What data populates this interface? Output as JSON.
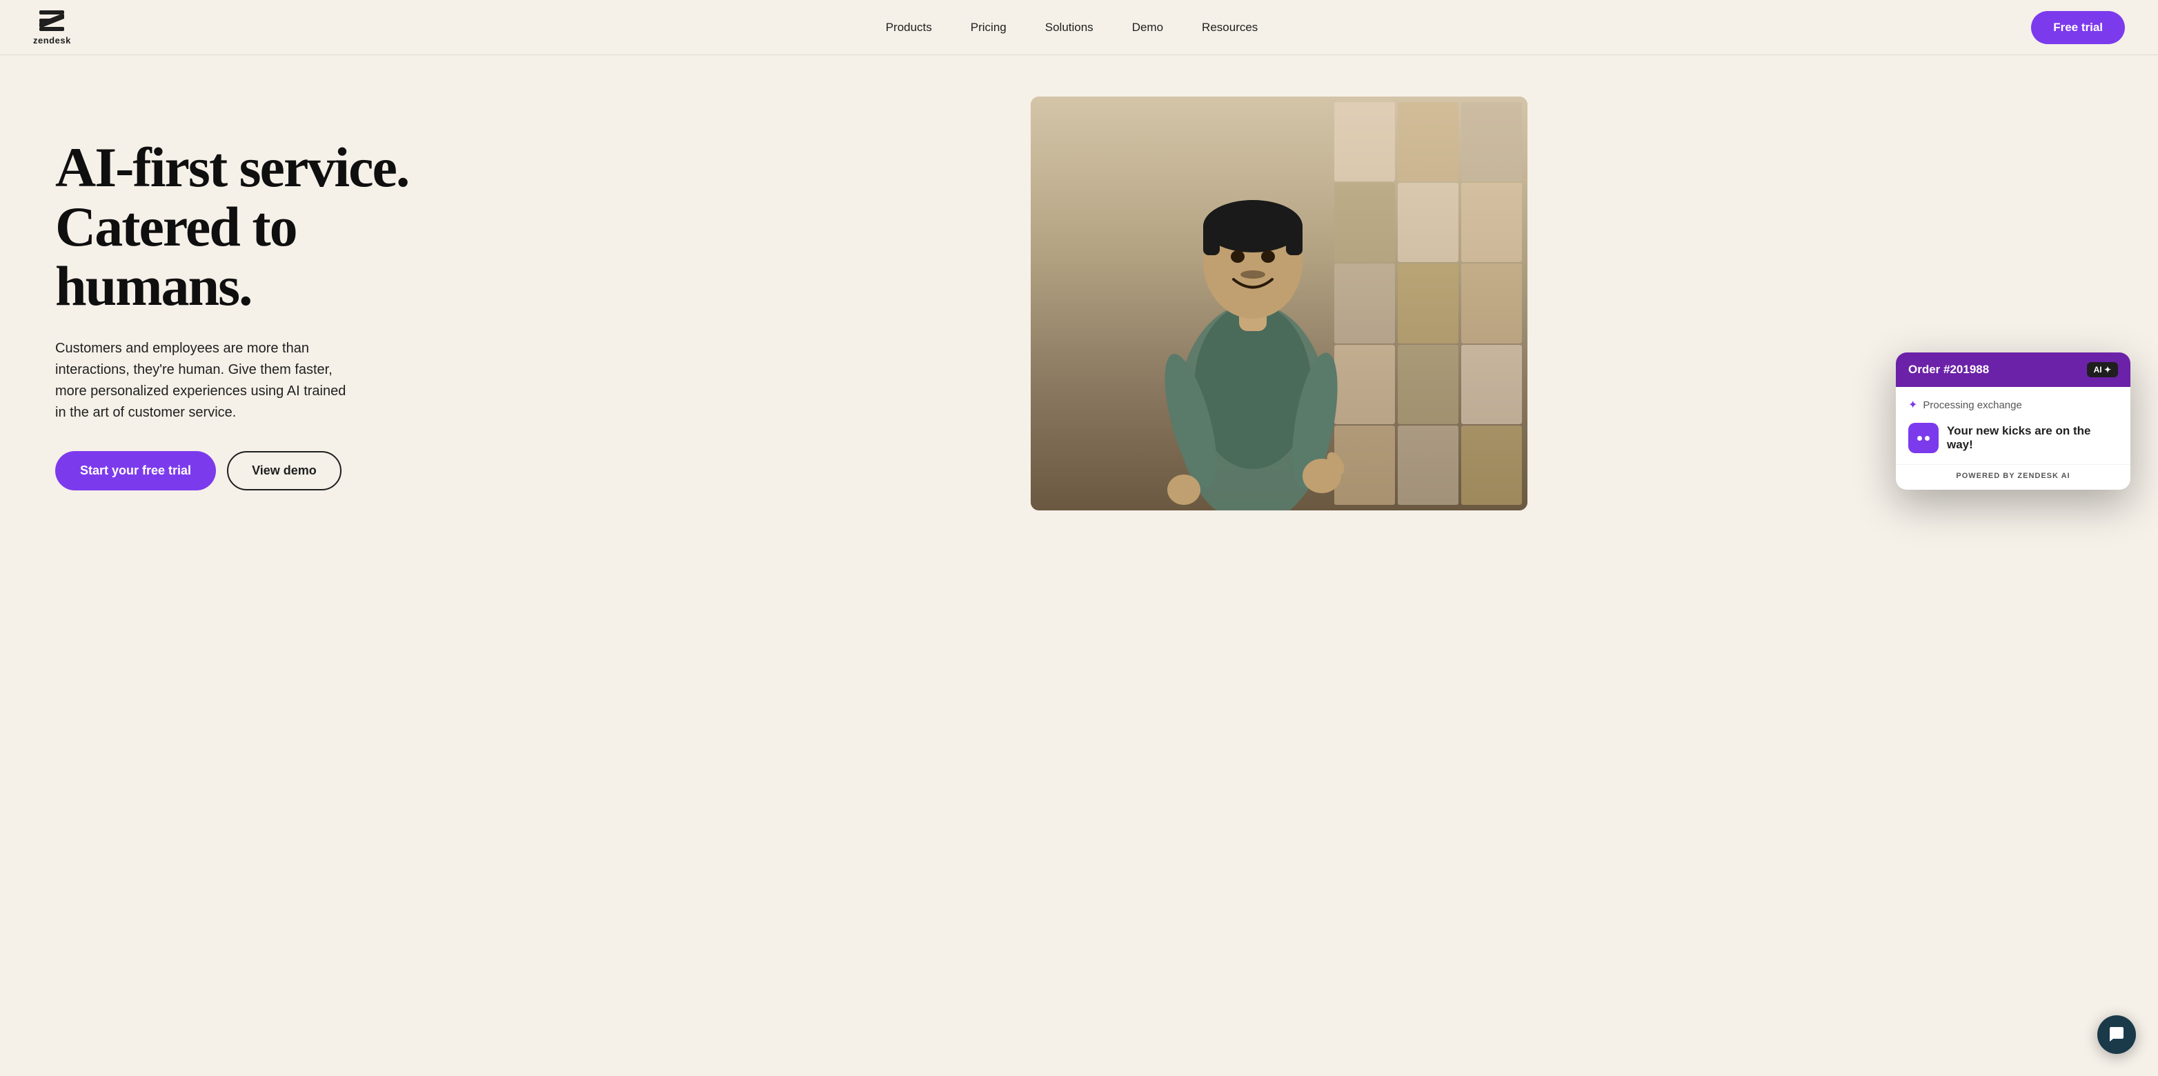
{
  "brand": {
    "name": "zendesk",
    "logo_alt": "Zendesk logo"
  },
  "nav": {
    "links": [
      {
        "id": "products",
        "label": "Products"
      },
      {
        "id": "pricing",
        "label": "Pricing"
      },
      {
        "id": "solutions",
        "label": "Solutions"
      },
      {
        "id": "demo",
        "label": "Demo"
      },
      {
        "id": "resources",
        "label": "Resources"
      }
    ],
    "cta_label": "Free trial"
  },
  "hero": {
    "headline_line1": "AI-first service.",
    "headline_line2": "Catered to",
    "headline_line3": "humans.",
    "subtext": "Customers and employees are more than interactions, they're human. Give them faster, more personalized experiences using AI trained in the art of customer service.",
    "btn_primary_label": "Start your free trial",
    "btn_secondary_label": "View demo"
  },
  "chat_widget": {
    "order_label": "Order #201988",
    "ai_badge": "AI ✦",
    "processing_text": "Processing exchange",
    "message_text": "Your new kicks are on the way!",
    "powered_by": "POWERED BY ZENDESK AI"
  },
  "colors": {
    "brand_purple": "#7c3aed",
    "nav_bg": "#f5f0e8",
    "hero_bg": "#f5f0e8",
    "dark_text": "#0f0f0f"
  }
}
